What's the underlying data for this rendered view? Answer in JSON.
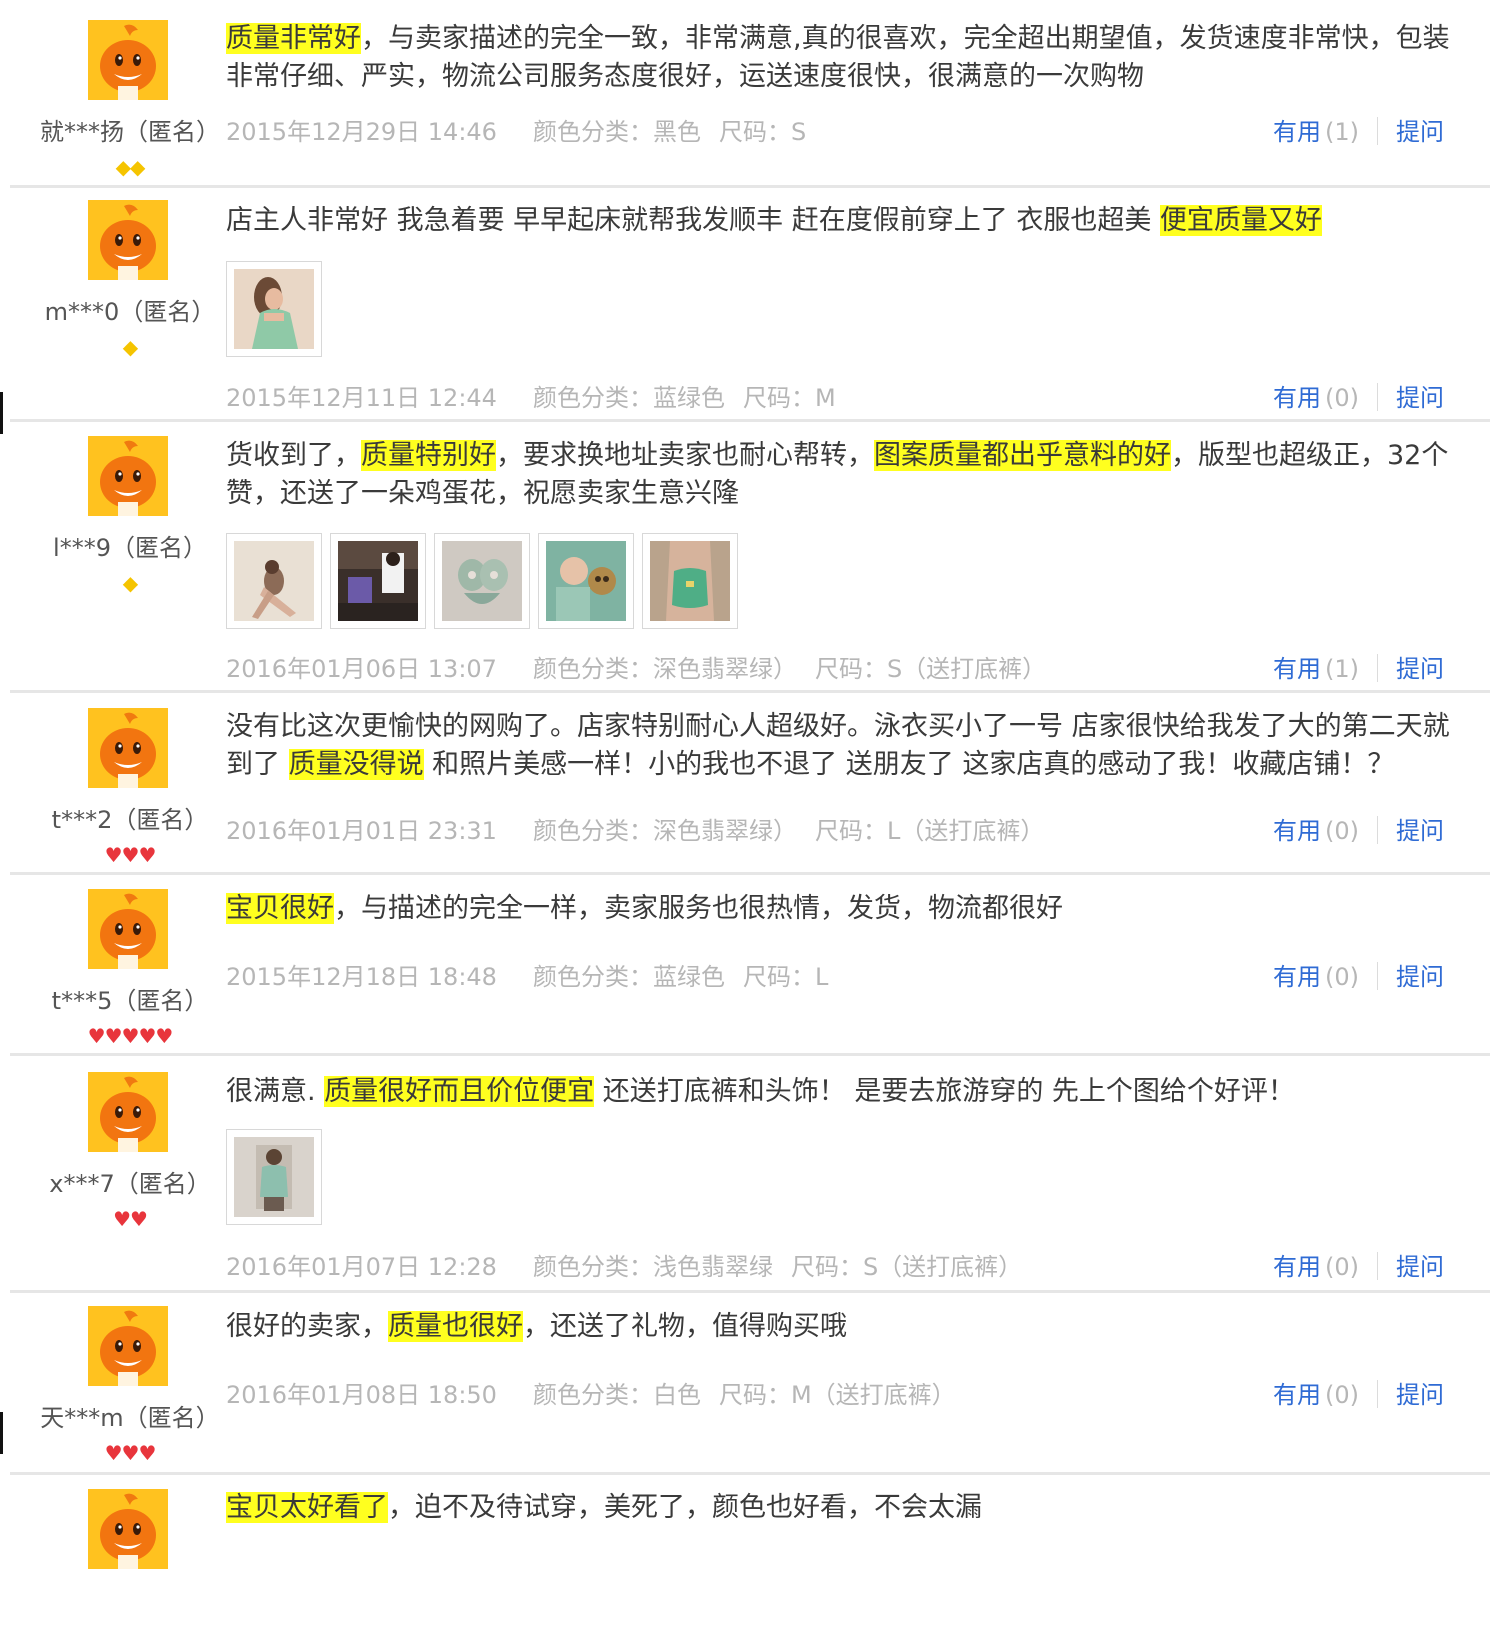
{
  "colors": {
    "highlight": "#ffff1f",
    "link": "#2f6bd4",
    "meta": "#b6b6b6",
    "avatar": "#ffc21f",
    "divider": "#e6e6e6"
  },
  "actions": {
    "useful_label": "有用",
    "ask_label": "提问"
  },
  "reviews": [
    {
      "user": "就***扬（匿名）",
      "badge": {
        "type": "yellow-diamond",
        "count": 2,
        "glyph": "◆◆"
      },
      "text": [
        {
          "t": "质量非常好",
          "hl": true
        },
        {
          "t": "，与卖家描述的完全一致，非常满意,真的很喜欢，完全超出期望值，发货速度非常快，包装非常仔细、严实，物流公司服务态度很好，运送速度很快，很满意的一次购物"
        }
      ],
      "photos": [],
      "date": "2015年12月29日 14:46",
      "sku": "颜色分类：黑色",
      "size": "尺码：S",
      "useful_count": "(1)"
    },
    {
      "user": "m***0（匿名）",
      "badge": {
        "type": "yellow-diamond",
        "count": 1,
        "glyph": "◆"
      },
      "text": [
        {
          "t": "店主人非常好 我急着要 早早起床就帮我发顺丰 赶在度假前穿上了 衣服也超美 "
        },
        {
          "t": "便宜质量又好",
          "hl": true
        }
      ],
      "photos": [
        "photo-woman-mint-top"
      ],
      "date": "2015年12月11日 12:44",
      "sku": "颜色分类：蓝绿色",
      "size": "尺码：M",
      "useful_count": "(0)"
    },
    {
      "user": "l***9（匿名）",
      "badge": {
        "type": "yellow-diamond",
        "count": 1,
        "glyph": "◆"
      },
      "text": [
        {
          "t": "货收到了，"
        },
        {
          "t": "质量特别好",
          "hl": true
        },
        {
          "t": "，要求换地址卖家也耐心帮转，"
        },
        {
          "t": "图案质量都出乎意料的好",
          "hl": true
        },
        {
          "t": "，版型也超级正，32个赞，还送了一朵鸡蛋花，祝愿卖家生意兴隆"
        }
      ],
      "photos": [
        "photo-beach-pose",
        "photo-room-selfie",
        "photo-swimsuit-flat",
        "photo-people-closeup",
        "photo-green-swimsuit"
      ],
      "date": "2016年01月06日 13:07",
      "sku": "颜色分类：深色翡翠绿）",
      "size": "尺码：S（送打底裤）",
      "useful_count": "(1)"
    },
    {
      "user": "t***2（匿名）",
      "badge": {
        "type": "red-heart",
        "count": 3,
        "glyph": "♥♥♥"
      },
      "text": [
        {
          "t": "没有比这次更愉快的网购了。店家特别耐心人超级好。泳衣买小了一号 店家很快给我发了大的第二天就到了 "
        },
        {
          "t": "质量没得说",
          "hl": true
        },
        {
          "t": " 和照片美感一样！小的我也不退了 送朋友了 这家店真的感动了我！收藏店铺！？"
        }
      ],
      "photos": [],
      "date": "2016年01月01日 23:31",
      "sku": "颜色分类：深色翡翠绿）",
      "size": "尺码：L（送打底裤）",
      "useful_count": "(0)"
    },
    {
      "user": "t***5（匿名）",
      "badge": {
        "type": "red-heart",
        "count": 5,
        "glyph": "♥♥♥♥♥"
      },
      "text": [
        {
          "t": "宝贝很好",
          "hl": true
        },
        {
          "t": "，与描述的完全一样，卖家服务也很热情，发货，物流都很好"
        }
      ],
      "photos": [],
      "date": "2015年12月18日 18:48",
      "sku": "颜色分类：蓝绿色",
      "size": "尺码：L",
      "useful_count": "(0)"
    },
    {
      "user": "x***7（匿名）",
      "badge": {
        "type": "red-heart",
        "count": 2,
        "glyph": "♥♥"
      },
      "text": [
        {
          "t": "很满意. "
        },
        {
          "t": "质量很好而且价位便宜",
          "hl": true
        },
        {
          "t": " 还送打底裤和头饰！ 是要去旅游穿的 先上个图给个好评！"
        }
      ],
      "photos": [
        "photo-mirror-selfie"
      ],
      "date": "2016年01月07日 12:28",
      "sku": "颜色分类：浅色翡翠绿",
      "size": "尺码：S（送打底裤）",
      "useful_count": "(0)"
    },
    {
      "user": "天***m（匿名）",
      "badge": {
        "type": "red-heart",
        "count": 3,
        "glyph": "♥♥♥"
      },
      "text": [
        {
          "t": "很好的卖家，"
        },
        {
          "t": "质量也很好",
          "hl": true
        },
        {
          "t": "，还送了礼物，值得购买哦"
        }
      ],
      "photos": [],
      "date": "2016年01月08日 18:50",
      "sku": "颜色分类：白色",
      "size": "尺码：M（送打底裤）",
      "useful_count": "(0)"
    },
    {
      "user": "",
      "badge": {
        "type": "none",
        "count": 0,
        "glyph": ""
      },
      "text": [
        {
          "t": "宝贝太好看了",
          "hl": true
        },
        {
          "t": "，迫不及待试穿，美死了，颜色也好看，不会太漏"
        }
      ],
      "photos": [],
      "date": "",
      "sku": "",
      "size": "",
      "useful_count": ""
    }
  ]
}
